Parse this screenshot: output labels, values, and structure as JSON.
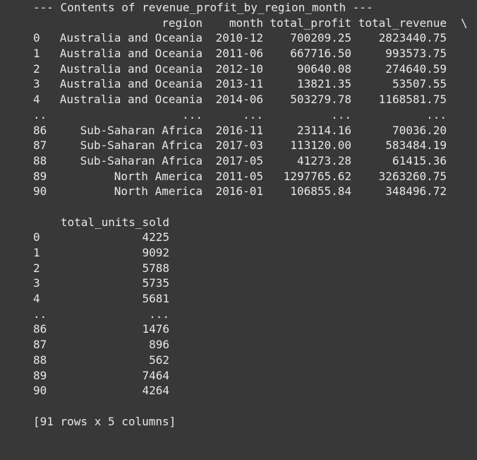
{
  "output": {
    "header": "--- Contents of revenue_profit_by_region_month ---",
    "table1": {
      "columns": {
        "region": "region",
        "month": "month",
        "total_profit": "total_profit",
        "total_revenue": "total_revenue",
        "continuation": "\\"
      },
      "rows": [
        {
          "index": "0",
          "region": "Australia and Oceania",
          "month": "2010-12",
          "total_profit": "700209.25",
          "total_revenue": "2823440.75"
        },
        {
          "index": "1",
          "region": "Australia and Oceania",
          "month": "2011-06",
          "total_profit": "667716.50",
          "total_revenue": "993573.75"
        },
        {
          "index": "2",
          "region": "Australia and Oceania",
          "month": "2012-10",
          "total_profit": "90640.08",
          "total_revenue": "274640.59"
        },
        {
          "index": "3",
          "region": "Australia and Oceania",
          "month": "2013-11",
          "total_profit": "13821.35",
          "total_revenue": "53507.55"
        },
        {
          "index": "4",
          "region": "Australia and Oceania",
          "month": "2014-06",
          "total_profit": "503279.78",
          "total_revenue": "1168581.75"
        },
        {
          "index": "..",
          "region": "...",
          "month": "...",
          "total_profit": "...",
          "total_revenue": "..."
        },
        {
          "index": "86",
          "region": "Sub-Saharan Africa",
          "month": "2016-11",
          "total_profit": "23114.16",
          "total_revenue": "70036.20"
        },
        {
          "index": "87",
          "region": "Sub-Saharan Africa",
          "month": "2017-03",
          "total_profit": "113120.00",
          "total_revenue": "583484.19"
        },
        {
          "index": "88",
          "region": "Sub-Saharan Africa",
          "month": "2017-05",
          "total_profit": "41273.28",
          "total_revenue": "61415.36"
        },
        {
          "index": "89",
          "region": "North America",
          "month": "2011-05",
          "total_profit": "1297765.62",
          "total_revenue": "3263260.75"
        },
        {
          "index": "90",
          "region": "North America",
          "month": "2016-01",
          "total_profit": "106855.84",
          "total_revenue": "348496.72"
        }
      ]
    },
    "table2": {
      "columns": {
        "total_units_sold": "total_units_sold"
      },
      "rows": [
        {
          "index": "0",
          "total_units_sold": "4225"
        },
        {
          "index": "1",
          "total_units_sold": "9092"
        },
        {
          "index": "2",
          "total_units_sold": "5788"
        },
        {
          "index": "3",
          "total_units_sold": "5735"
        },
        {
          "index": "4",
          "total_units_sold": "5681"
        },
        {
          "index": "..",
          "total_units_sold": "..."
        },
        {
          "index": "86",
          "total_units_sold": "1476"
        },
        {
          "index": "87",
          "total_units_sold": "896"
        },
        {
          "index": "88",
          "total_units_sold": "562"
        },
        {
          "index": "89",
          "total_units_sold": "7464"
        },
        {
          "index": "90",
          "total_units_sold": "4264"
        }
      ]
    },
    "footer": "[91 rows x 5 columns]"
  }
}
